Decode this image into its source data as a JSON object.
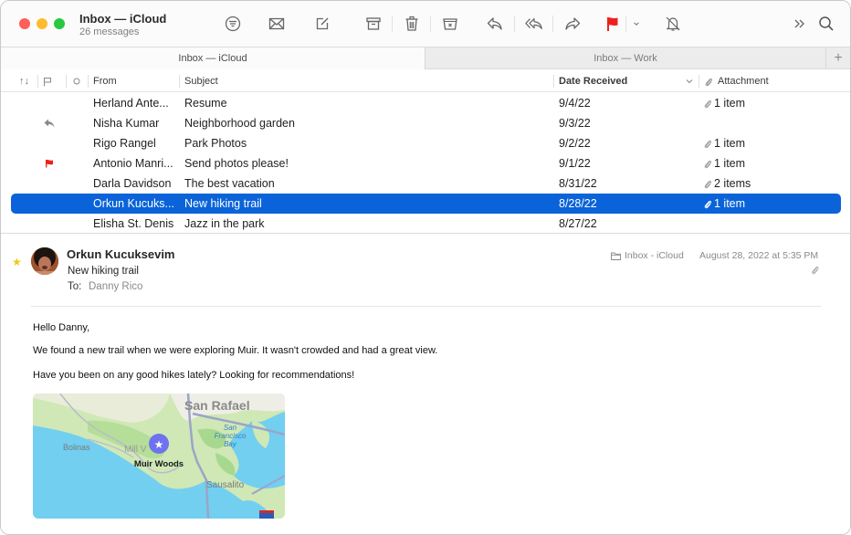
{
  "window": {
    "title": "Inbox — iCloud",
    "subtitle": "26 messages"
  },
  "toolbar": {
    "buttons": [
      {
        "name": "filter",
        "icon": "filter-icon"
      },
      {
        "name": "get-mail",
        "icon": "envelope-icon"
      },
      {
        "name": "compose",
        "icon": "compose-icon"
      },
      {
        "name": "archive",
        "icon": "archive-icon"
      },
      {
        "name": "delete",
        "icon": "trash-icon"
      },
      {
        "name": "junk",
        "icon": "junk-icon"
      },
      {
        "name": "reply",
        "icon": "reply-icon"
      },
      {
        "name": "reply-all",
        "icon": "reply-all-icon"
      },
      {
        "name": "forward",
        "icon": "forward-icon"
      },
      {
        "name": "flag",
        "icon": "flag-icon"
      },
      {
        "name": "flag-menu",
        "icon": "chevron-down-icon"
      },
      {
        "name": "mute",
        "icon": "bell-slash-icon"
      },
      {
        "name": "more",
        "icon": "chevron-double-right-icon"
      },
      {
        "name": "search",
        "icon": "search-icon"
      }
    ],
    "flag_color": "#f0201e"
  },
  "tabs": [
    {
      "label": "Inbox — iCloud",
      "active": true
    },
    {
      "label": "Inbox — Work",
      "active": false
    }
  ],
  "columns": {
    "sort": "↑↓",
    "from": "From",
    "subject": "Subject",
    "date": "Date Received",
    "attachment": "Attachment"
  },
  "messages": [
    {
      "from": "Herland Ante...",
      "subject": "Resume",
      "date": "9/4/22",
      "attachment": "1 item",
      "status": ""
    },
    {
      "from": "Nisha Kumar",
      "subject": "Neighborhood garden",
      "date": "9/3/22",
      "attachment": "",
      "status": "replied"
    },
    {
      "from": "Rigo Rangel",
      "subject": "Park Photos",
      "date": "9/2/22",
      "attachment": "1 item",
      "status": ""
    },
    {
      "from": "Antonio Manri...",
      "subject": "Send photos please!",
      "date": "9/1/22",
      "attachment": "1 item",
      "status": "flagged"
    },
    {
      "from": "Darla Davidson",
      "subject": "The best vacation",
      "date": "8/31/22",
      "attachment": "2 items",
      "status": ""
    },
    {
      "from": "Orkun Kucuks...",
      "subject": "New hiking trail",
      "date": "8/28/22",
      "attachment": "1 item",
      "status": "",
      "selected": true
    },
    {
      "from": "Elisha St. Denis",
      "subject": "Jazz in the park",
      "date": "8/27/22",
      "attachment": "",
      "status": ""
    }
  ],
  "selection_color": "#0a63d8",
  "message": {
    "sender": "Orkun Kucuksevim",
    "subject": "New hiking trail",
    "to_label": "To:",
    "to": "Danny Rico",
    "mailbox": "Inbox - iCloud",
    "date": "August 28, 2022 at 5:35 PM",
    "body": [
      "Hello Danny,",
      "We found a new trail when we were exploring Muir. It wasn't crowded and had a great view.",
      "Have you been on any good hikes lately? Looking for recommendations!"
    ],
    "map": {
      "pin_label": "Muir Woods",
      "places": [
        "San Rafael",
        "San Francisco Bay",
        "Bolinas",
        "Mill Valley",
        "Sausalito"
      ],
      "bay_line1": "San",
      "bay_line2": "Francisco",
      "bay_line3": "Bay",
      "mill_valley": "Mill V"
    }
  }
}
